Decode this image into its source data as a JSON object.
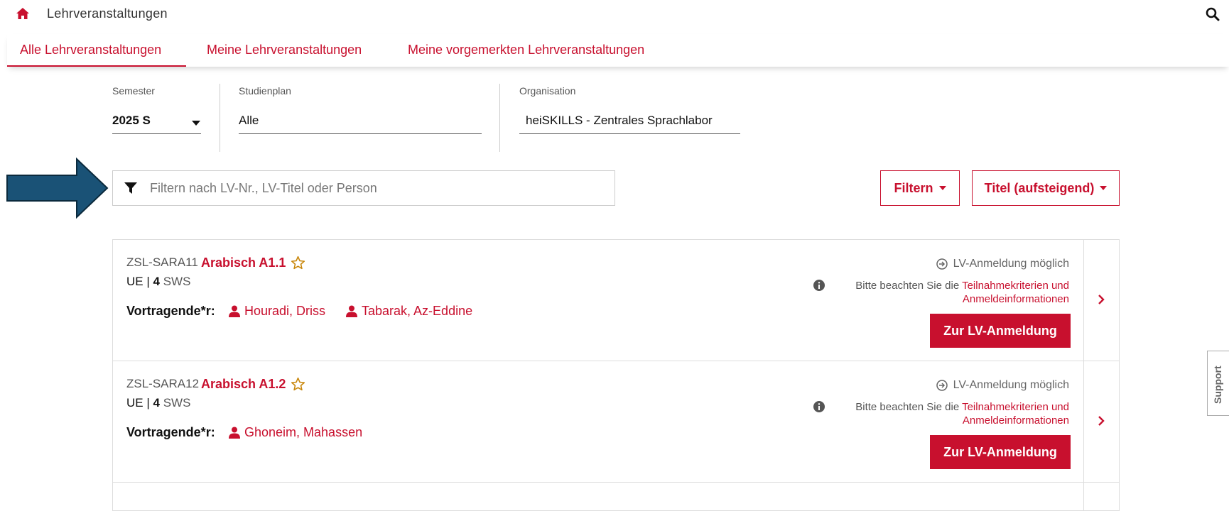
{
  "header": {
    "title": "Lehrveranstaltungen",
    "home_icon": "home-icon",
    "search_icon": "search-icon"
  },
  "tabs": [
    {
      "label": "Alle Lehrveranstaltungen",
      "active": true
    },
    {
      "label": "Meine Lehrveranstaltungen",
      "active": false
    },
    {
      "label": "Meine vorgemerkten Lehrveranstaltungen",
      "active": false
    }
  ],
  "selectors": {
    "semester": {
      "label": "Semester",
      "value": "2025 S"
    },
    "studienplan": {
      "label": "Studienplan",
      "value": "Alle"
    },
    "organisation": {
      "label": "Organisation",
      "value": "heiSKILLS - Zentrales Sprachlabor"
    }
  },
  "filter": {
    "placeholder": "Filtern nach LV-Nr., LV-Titel oder Person",
    "filter_label": "Filtern",
    "sort_label": "Titel (aufsteigend)"
  },
  "courses": [
    {
      "code": "ZSL-SARA11",
      "title": "Arabisch A1.1",
      "type": "UE",
      "sws": "4",
      "sws_unit": "SWS",
      "lecturers_label": "Vortragende*r:",
      "lecturers": [
        "Houradi, Driss",
        "Tabarak, Az-Eddine"
      ],
      "status": "LV-Anmeldung möglich",
      "info_prefix": "Bitte beachten Sie die ",
      "info_link": "Teilnahmekriterien und Anmeldeinformationen",
      "button": "Zur LV-Anmeldung"
    },
    {
      "code": "ZSL-SARA12",
      "title": "Arabisch A1.2",
      "type": "UE",
      "sws": "4",
      "sws_unit": "SWS",
      "lecturers_label": "Vortragende*r:",
      "lecturers": [
        "Ghoneim, Mahassen"
      ],
      "status": "LV-Anmeldung möglich",
      "info_prefix": "Bitte beachten Sie die ",
      "info_link": "Teilnahmekriterien und Anmeldeinformationen",
      "button": "Zur LV-Anmeldung"
    }
  ],
  "support": {
    "label": "Support"
  },
  "colors": {
    "accent": "#c8102e",
    "arrow_fill": "#1a5276",
    "arrow_stroke": "#0b2a3d",
    "star": "#c8860a"
  }
}
